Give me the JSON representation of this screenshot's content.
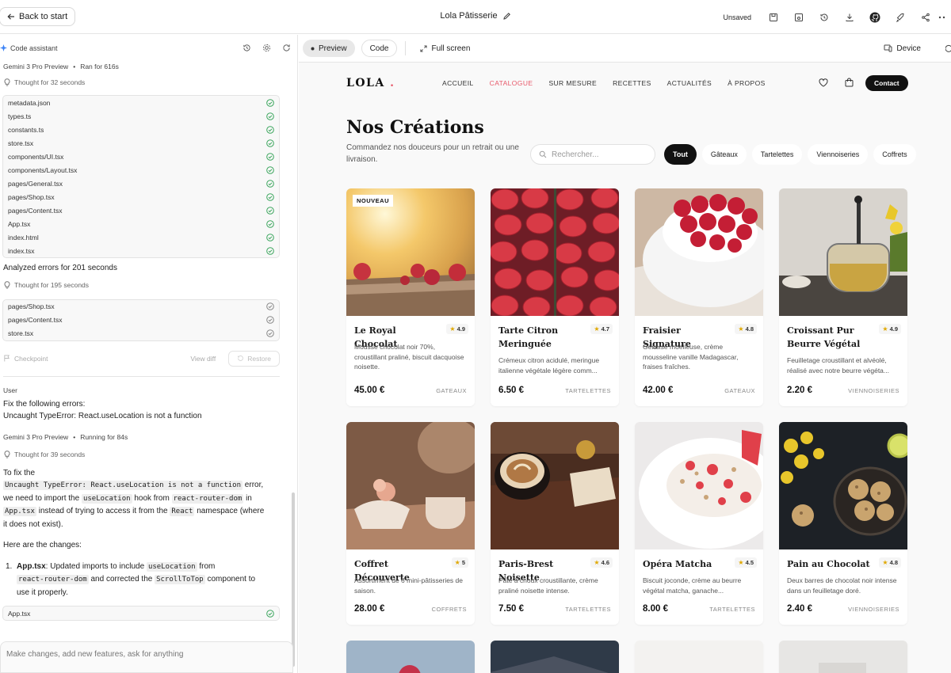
{
  "topbar": {
    "back_label": "Back to start",
    "app_title": "Lola Pâtisserie",
    "status": "Unsaved"
  },
  "assistant": {
    "title": "Code assistant",
    "model": "Gemini 3 Pro Preview",
    "ran_for": "Ran for 616s",
    "thought_1": "Thought for 32 seconds",
    "files_1": [
      "metadata.json",
      "types.ts",
      "constants.ts",
      "store.tsx",
      "components/UI.tsx",
      "components/Layout.tsx",
      "pages/General.tsx",
      "pages/Shop.tsx",
      "pages/Content.tsx",
      "App.tsx",
      "index.html",
      "index.tsx"
    ],
    "analyzed": "Analyzed errors for 201 seconds",
    "thought_2": "Thought for 195 seconds",
    "files_2": [
      "pages/Shop.tsx",
      "pages/Content.tsx",
      "store.tsx"
    ],
    "checkpoint": "Checkpoint",
    "view_diff": "View diff",
    "restore": "Restore",
    "user_label": "User",
    "user_msg_1": "Fix the following errors:",
    "user_msg_2": "Uncaught TypeError: React.useLocation is not a function",
    "model_2": "Gemini 3 Pro Preview",
    "running": "Running for 84s",
    "thought_3": "Thought for 39 seconds",
    "resp_intro": "To fix the",
    "resp_code_err": "Uncaught TypeError: React.useLocation is not a function",
    "resp_error": "error,",
    "resp_we_need": "we need to import the",
    "resp_code_hook": "useLocation",
    "resp_hook_from": "hook from",
    "resp_code_rrd": "react-router-dom",
    "resp_in": "in",
    "resp_code_app": "App.tsx",
    "resp_instead": "instead of trying to access it from the",
    "resp_code_react": "React",
    "resp_namespace": "namespace (where",
    "resp_not_exist": "it does not exist).",
    "changes_heading": "Here are the changes:",
    "change_num": "1.",
    "change_file": "App.tsx",
    "change_a": ": Updated imports to include",
    "change_code_loc": "useLocation",
    "change_from": "from",
    "change_code_rrd": "react-router-dom",
    "change_b": "and corrected the",
    "change_code_scroll": "ScrollToTop",
    "change_c": "component to",
    "change_d": "use it properly.",
    "file_3": "App.tsx",
    "prompt_placeholder": "Make changes, add new features, ask for anything"
  },
  "preview_toolbar": {
    "preview": "Preview",
    "code": "Code",
    "fullscreen": "Full screen",
    "device": "Device"
  },
  "site": {
    "logo": "LOLA",
    "logo_dot": ".",
    "nav": [
      "ACCUEIL",
      "CATALOGUE",
      "SUR MESURE",
      "RECETTES",
      "ACTUALITÉS",
      "À PROPOS"
    ],
    "contact": "Contact",
    "title": "Nos Créations",
    "subtitle": "Commandez nos douceurs pour un retrait ou une livraison.",
    "search_placeholder": "Rechercher...",
    "filters": [
      "Tout",
      "Gâteaux",
      "Tartelettes",
      "Viennoiseries",
      "Coffrets"
    ],
    "accent": "#e8596a",
    "products": [
      {
        "name": "Le Royal Chocolat",
        "rating": "4.9",
        "desc": "Mousse chocolat noir 70%, croustillant praliné, biscuit dacquoise noisette.",
        "price": "45.00 €",
        "category": "GATEAUX",
        "badge": "NOUVEAU"
      },
      {
        "name": "Tarte Citron Meringuée",
        "rating": "4.7",
        "desc": "Crémeux citron acidulé, meringue italienne végétale légère comm...",
        "price": "6.50 €",
        "category": "TARTELETTES"
      },
      {
        "name": "Fraisier Signature",
        "rating": "4.8",
        "desc": "Génoise moelleuse, crème mousseline vanille Madagascar, fraises fraîches.",
        "price": "42.00 €",
        "category": "GATEAUX"
      },
      {
        "name": "Croissant Pur Beurre Végétal",
        "rating": "4.9",
        "desc": "Feuilletage croustillant et alvéolé, réalisé avec notre beurre végéta...",
        "price": "2.20 €",
        "category": "VIENNOISERIES"
      },
      {
        "name": "Coffret Découverte",
        "rating": "5",
        "desc": "Assortiment de 6 mini-pâtisseries de saison.",
        "price": "28.00 €",
        "category": "COFFRETS"
      },
      {
        "name": "Paris-Brest Noisette",
        "rating": "4.6",
        "desc": "Pâte à choux croustillante, crème praliné noisette intense.",
        "price": "7.50 €",
        "category": "TARTELETTES"
      },
      {
        "name": "Opéra Matcha",
        "rating": "4.5",
        "desc": "Biscuit joconde, crème au beurre végétal matcha, ganache...",
        "price": "8.00 €",
        "category": "TARTELETTES"
      },
      {
        "name": "Pain au Chocolat",
        "rating": "4.8",
        "desc": "Deux barres de chocolat noir intense dans un feuilletage doré.",
        "price": "2.40 €",
        "category": "VIENNOISERIES"
      }
    ]
  }
}
